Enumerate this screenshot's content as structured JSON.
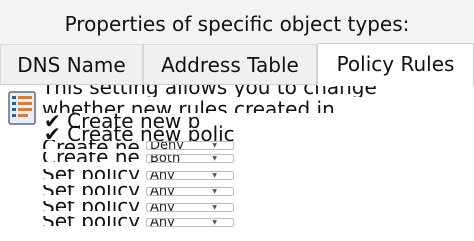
{
  "heading": "Properties of specific object types:",
  "tabs": [
    {
      "label": "DNS Name"
    },
    {
      "label": "Address Table"
    },
    {
      "label": "Policy Rules"
    }
  ],
  "active_tab": "Policy Rules",
  "panel": {
    "info_icon": "info-list-icon",
    "description_line1": "This setting allows you to change",
    "description_line2": "whether new rules created in",
    "checkboxes": [
      {
        "label": "Create new p",
        "checked": true
      },
      {
        "label": "Create new polic",
        "checked": true
      }
    ],
    "rows": [
      {
        "label": "Create ne",
        "value": "Deny"
      },
      {
        "label": "Create ne",
        "value": "Both"
      },
      {
        "label": "Set policy",
        "value": "Any"
      },
      {
        "label": "Set policy",
        "value": "Any"
      },
      {
        "label": "Set policy",
        "value": "Any"
      },
      {
        "label": "Set policy",
        "value": "Any"
      }
    ]
  }
}
